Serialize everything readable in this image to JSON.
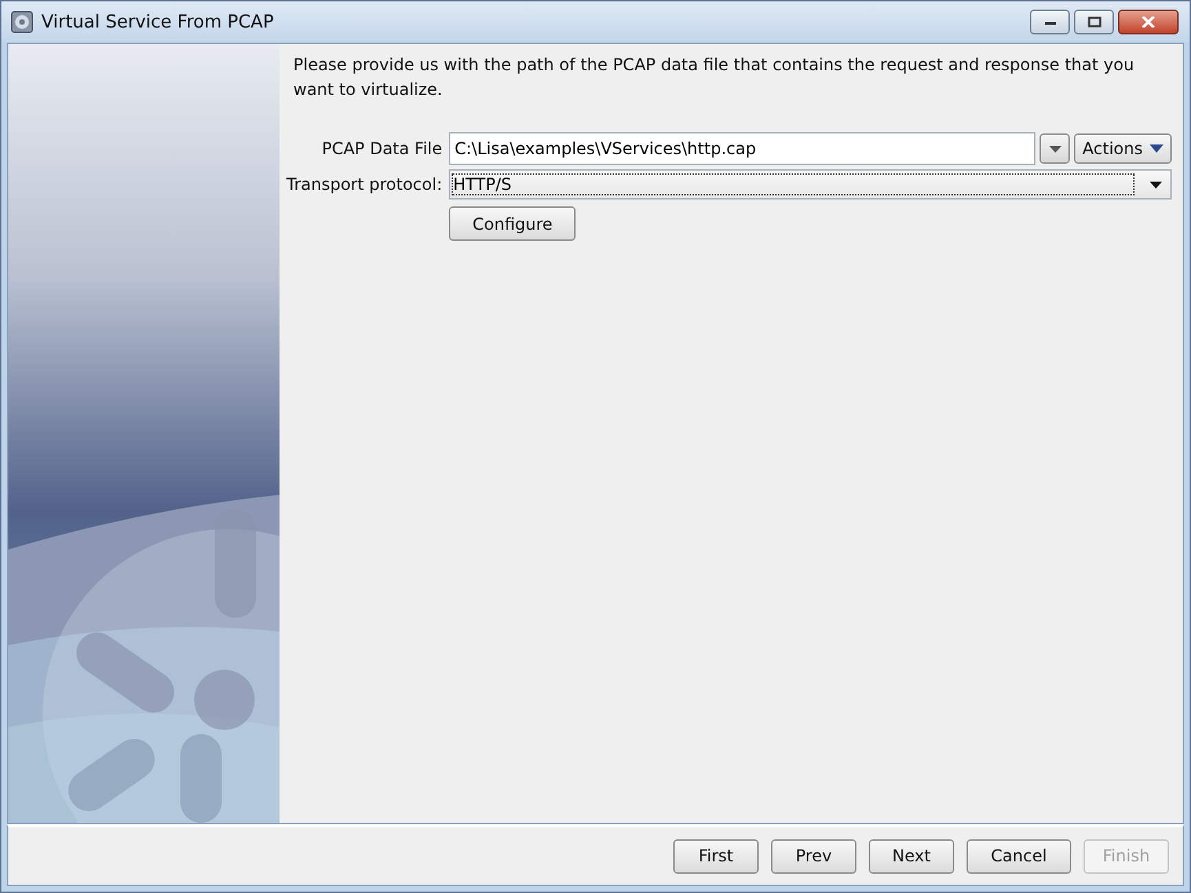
{
  "window": {
    "title": "Virtual Service From PCAP"
  },
  "instructions": "Please provide us with the path of the PCAP data file that contains the request and response that you want to virtualize.",
  "pcap_file": {
    "label": "PCAP Data File",
    "value": "C:\\Lisa\\examples\\VServices\\http.cap",
    "actions_label": "Actions"
  },
  "transport": {
    "label": "Transport protocol:",
    "value": "HTTP/S"
  },
  "configure_button": "Configure",
  "buttons": [
    {
      "label": "First",
      "disabled": false
    },
    {
      "label": "Prev",
      "disabled": false
    },
    {
      "label": "Next",
      "disabled": false
    },
    {
      "label": "Cancel",
      "disabled": false
    },
    {
      "label": "Finish",
      "disabled": true
    }
  ]
}
